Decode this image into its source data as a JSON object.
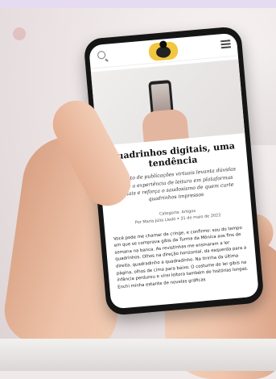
{
  "article": {
    "title": "Quadrinhos digitais, uma tendência",
    "subtitle": "Aumento de publicações virtuais levanta dúvidas sobre a experiência de leitura em plataformas digitais e reforça o saudosismo de quem curte quadrinhos impressos",
    "category": "Categoria: Artigos",
    "byline": "Por Maria Júlia Lledó",
    "date": "31 de maio de 2022",
    "body": "Você pode me chamar de cringe, e confirmo: sou do tempo em que se comprava gibis da Turma da Mônica aos fins de semana na banca. As revistinhas me ensinaram a ler quadrinhos. Olhos na direção horizontal, da esquerda para a direita, quadradinho a quadradinho. Na tirinha da última página, olhos de cima para baixo. O costume de ler gibis na infância perdurou e virei leitora também de histórias longas. Enchi minha estante de novelas gráficas"
  }
}
